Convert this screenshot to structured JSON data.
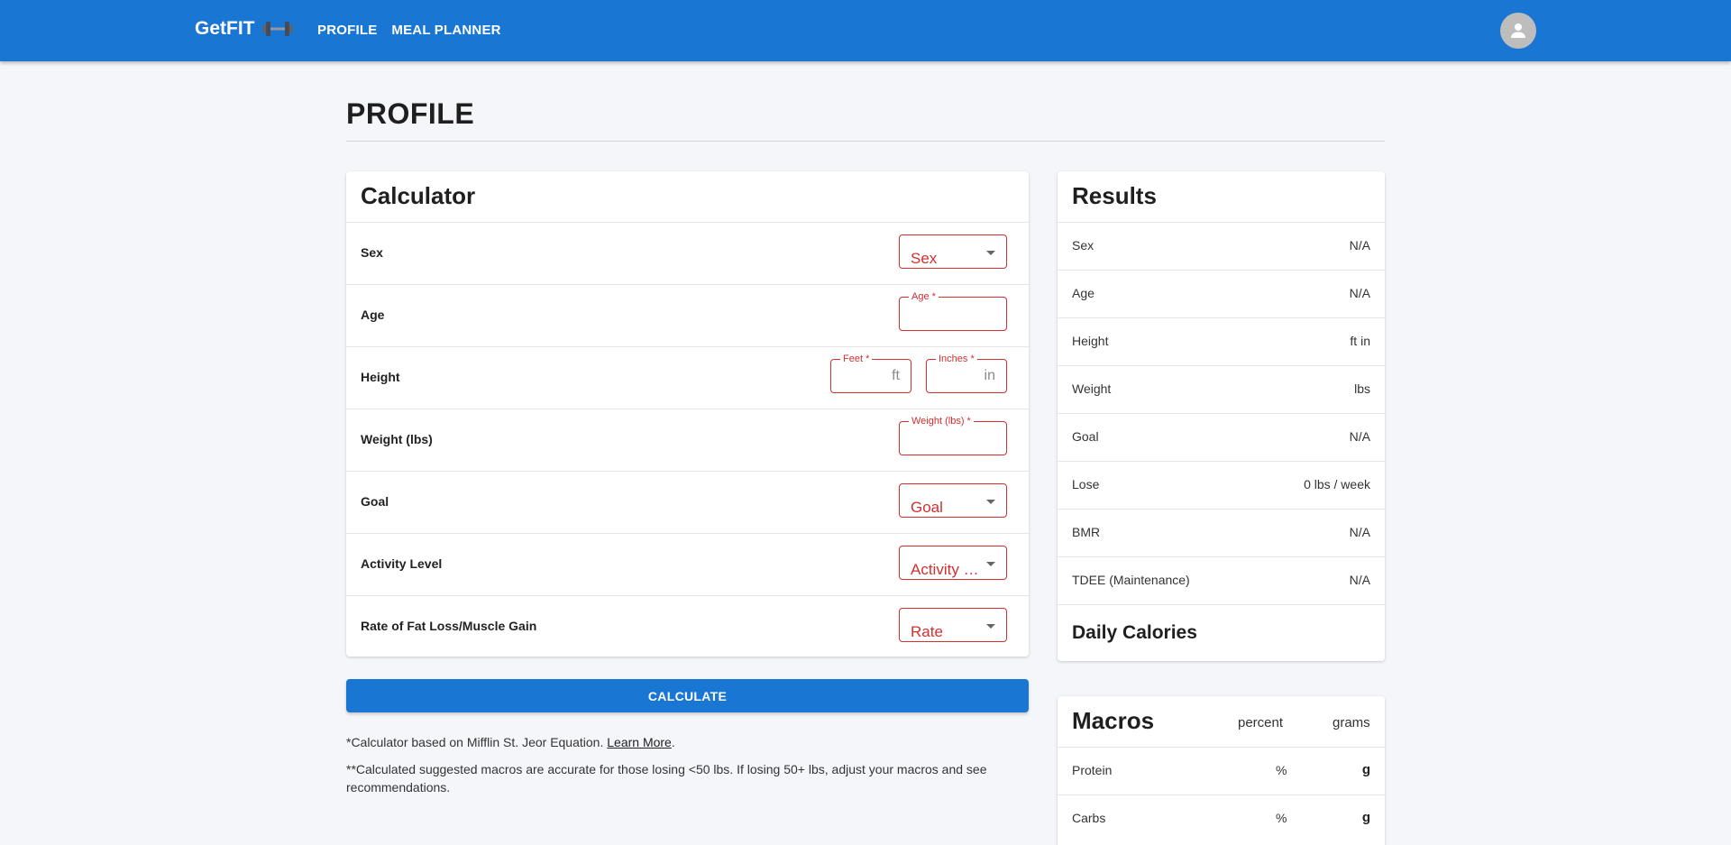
{
  "header": {
    "brand": "GetFIT",
    "nav": [
      "PROFILE",
      "MEAL PLANNER"
    ],
    "colors": {
      "primary": "#1976d2",
      "error": "#d32f2f"
    }
  },
  "page": {
    "title": "PROFILE"
  },
  "calculator": {
    "title": "Calculator",
    "rows": [
      {
        "label": "Sex",
        "fields": [
          {
            "kind": "select",
            "value": "Sex"
          }
        ]
      },
      {
        "label": "Age",
        "fields": [
          {
            "kind": "input",
            "label": "Age *"
          }
        ]
      },
      {
        "label": "Height",
        "fields": [
          {
            "kind": "input",
            "label": "Feet *",
            "unit": "ft"
          },
          {
            "kind": "input",
            "label": "Inches *",
            "unit": "in"
          }
        ]
      },
      {
        "label": "Weight (lbs)",
        "fields": [
          {
            "kind": "input",
            "label": "Weight (lbs) *"
          }
        ]
      },
      {
        "label": "Goal",
        "fields": [
          {
            "kind": "select",
            "value": "Goal"
          }
        ]
      },
      {
        "label": "Activity Level",
        "fields": [
          {
            "kind": "select",
            "value": "Activity Level"
          }
        ]
      },
      {
        "label": "Rate of Fat Loss/Muscle Gain",
        "fields": [
          {
            "kind": "select",
            "value": "Rate"
          }
        ]
      }
    ],
    "button": "CALCULATE",
    "note1_text": "*Calculator based on Mifflin St. Jeor Equation.",
    "note1_link": "Learn More",
    "note1_end": ".",
    "note2": "**Calculated suggested macros are accurate for those losing <50 lbs. If losing 50+ lbs, adjust your macros and see recommendations."
  },
  "results": {
    "title": "Results",
    "rows": [
      {
        "key": "Sex",
        "value": "N/A"
      },
      {
        "key": "Age",
        "value": "N/A"
      },
      {
        "key": "Height",
        "value": "ft in"
      },
      {
        "key": "Weight",
        "value": "lbs"
      },
      {
        "key": "Goal",
        "value": "N/A"
      },
      {
        "key": "Lose",
        "value": "0 lbs / week"
      },
      {
        "key": "BMR",
        "value": "N/A"
      },
      {
        "key": "TDEE (Maintenance)",
        "value": "N/A"
      }
    ],
    "daily_calories": "Daily Calories"
  },
  "macros": {
    "title": "Macros",
    "col_percent": "percent",
    "col_grams": "grams",
    "rows": [
      {
        "name": "Protein",
        "percent": "%",
        "grams": "g"
      },
      {
        "name": "Carbs",
        "percent": "%",
        "grams": "g"
      }
    ]
  }
}
